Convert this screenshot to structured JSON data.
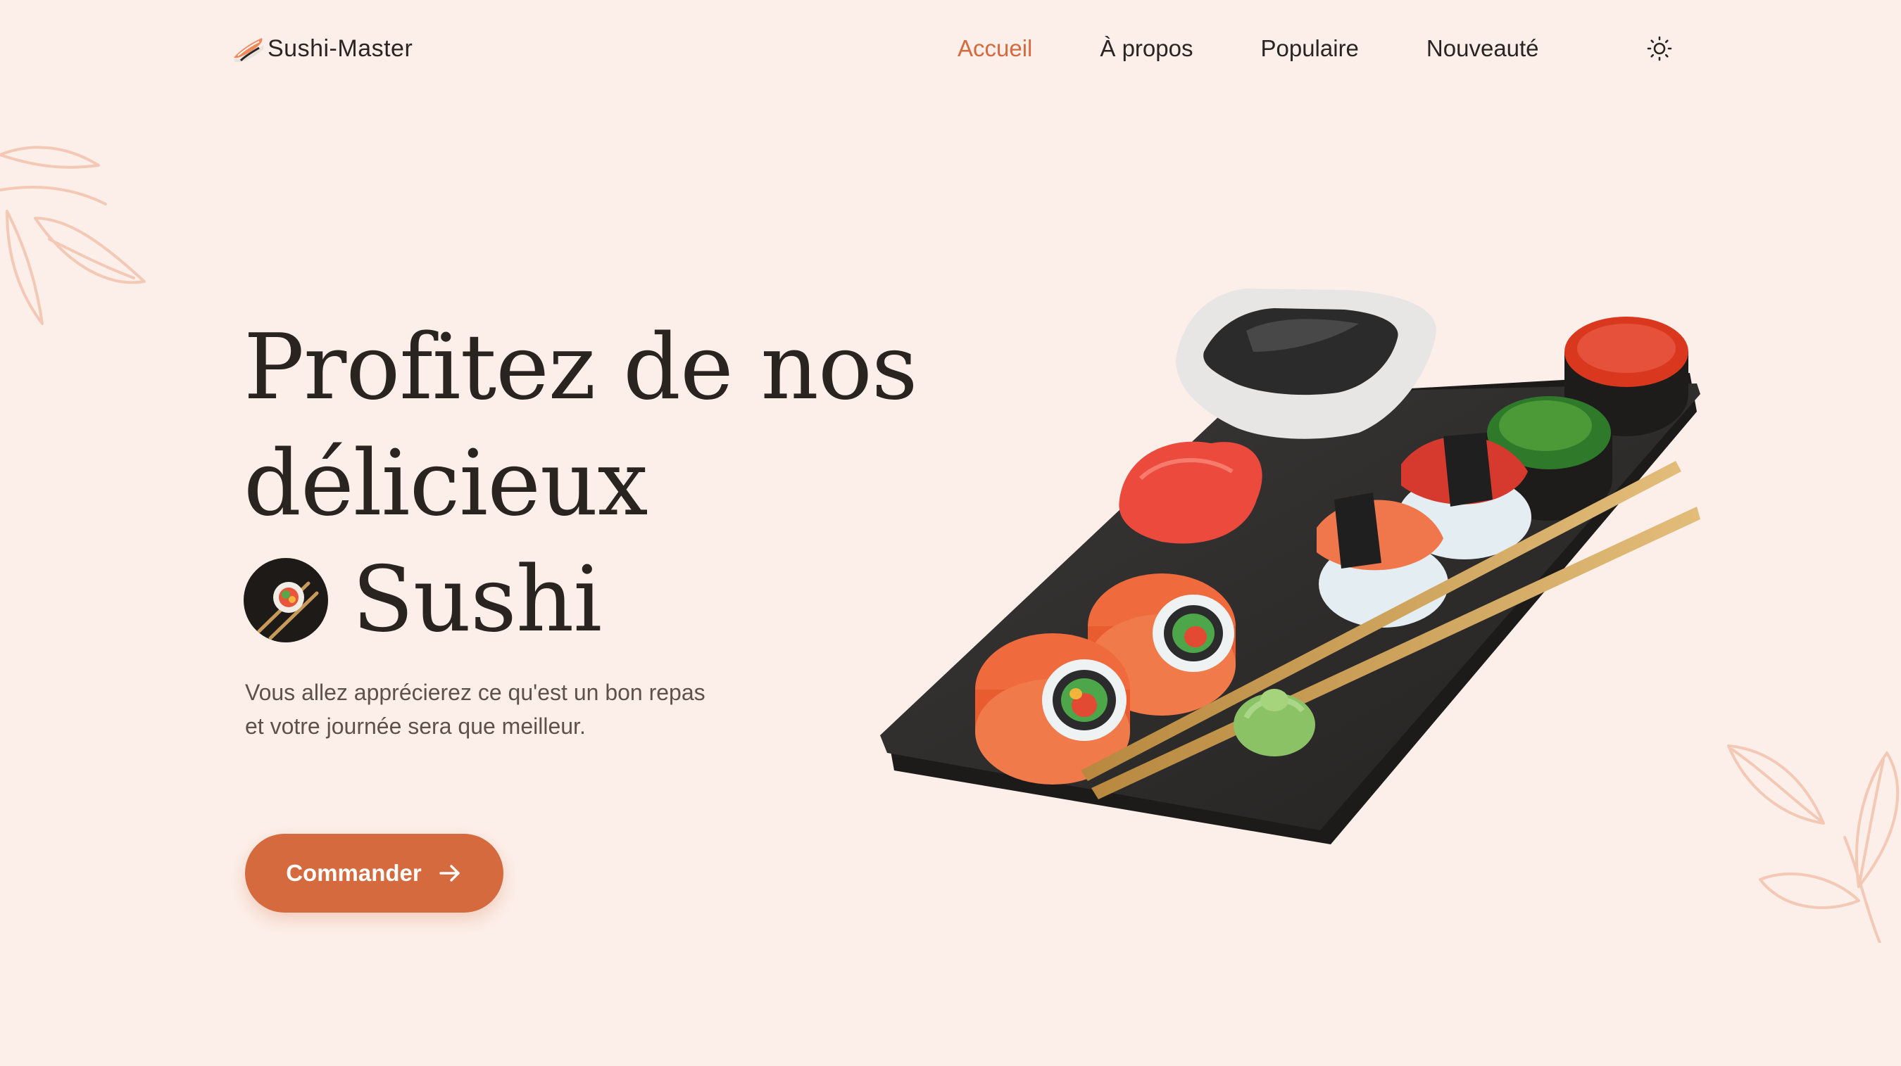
{
  "header": {
    "brand_name": "Sushi-Master",
    "brand_icon": "sushi-logo-icon",
    "nav": [
      {
        "label": "Accueil",
        "active": true
      },
      {
        "label": "À propos",
        "active": false
      },
      {
        "label": "Populaire",
        "active": false
      },
      {
        "label": "Nouveauté",
        "active": false
      }
    ],
    "theme_icon": "sun-icon"
  },
  "hero": {
    "title_line1": "Profitez de nos",
    "title_line2": "délicieux",
    "title_line3": "Sushi",
    "description": "Vous allez apprécierez ce qu'est un bon repas et votre journée sera que meilleur.",
    "cta_label": "Commander",
    "cta_icon": "arrow-right-icon",
    "badge_icon": "sushi-chopsticks-icon",
    "image": "sushi-platter-image"
  },
  "colors": {
    "background": "#fcefe9",
    "accent": "#d46a3d",
    "text": "#2a2522",
    "muted_text": "#5c514b"
  }
}
